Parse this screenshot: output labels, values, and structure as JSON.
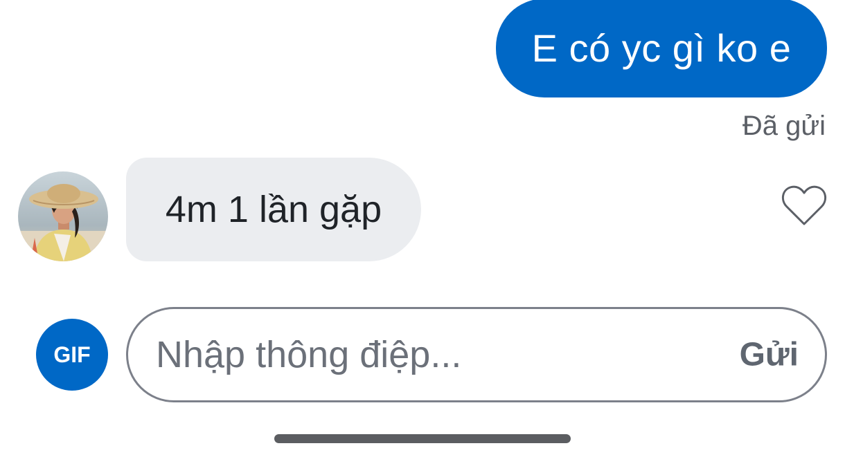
{
  "conversation": {
    "outgoing": {
      "text": "E có yc gì ko e",
      "status": "Đã gửi"
    },
    "incoming": {
      "text": "4m 1 lần gặp",
      "avatar_icon": "user-avatar-photo"
    },
    "reaction_icon": "heart-outline-icon"
  },
  "composer": {
    "gif_label": "GIF",
    "placeholder": "Nhập thông điệp...",
    "value": "",
    "send_label": "Gửi"
  },
  "colors": {
    "accent": "#0068c6",
    "incoming_bubble": "#ebedf0",
    "muted_text": "#5b5f66"
  }
}
